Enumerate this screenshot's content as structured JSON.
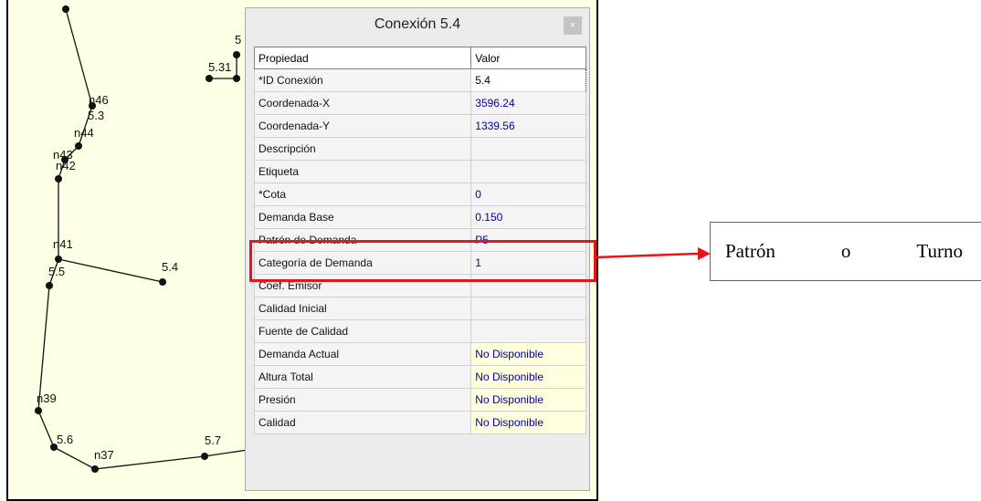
{
  "dialog": {
    "title": "Conexión 5.4",
    "close_glyph": "×",
    "headers": {
      "property": "Propiedad",
      "value": "Valor"
    },
    "rows": [
      {
        "property": "*ID Conexión",
        "value": "5.4"
      },
      {
        "property": "Coordenada-X",
        "value": "3596.24"
      },
      {
        "property": "Coordenada-Y",
        "value": "1339.56"
      },
      {
        "property": "Descripción",
        "value": ""
      },
      {
        "property": "Etiqueta",
        "value": ""
      },
      {
        "property": "*Cota",
        "value": "0"
      },
      {
        "property": "Demanda Base",
        "value": "0.150"
      },
      {
        "property": "Patrón de Demanda",
        "value": "P5"
      },
      {
        "property": "Categoría de Demanda",
        "value": "1"
      },
      {
        "property": "Coef. Emisor",
        "value": ""
      },
      {
        "property": "Calidad Inicial",
        "value": ""
      },
      {
        "property": "Fuente de Calidad",
        "value": ""
      },
      {
        "property": "Demanda Actual",
        "value": "No Disponible"
      },
      {
        "property": "Altura Total",
        "value": "No Disponible"
      },
      {
        "property": "Presión",
        "value": "No Disponible"
      },
      {
        "property": "Calidad",
        "value": "No Disponible"
      }
    ]
  },
  "map": {
    "labels": [
      "5.3",
      "n46",
      "n44",
      "n43",
      "n42",
      "n41",
      "5.5",
      "5.4",
      "n39",
      "5.6",
      "n37",
      "5.7",
      "5.31",
      "5"
    ]
  },
  "callout": {
    "words": [
      "Patrón",
      "o",
      "Turno"
    ]
  },
  "colors": {
    "highlight": "#e8141b",
    "callout_border": "#3f6ea8",
    "map_background": "#ffffe6",
    "value_text": "#0000a0"
  }
}
